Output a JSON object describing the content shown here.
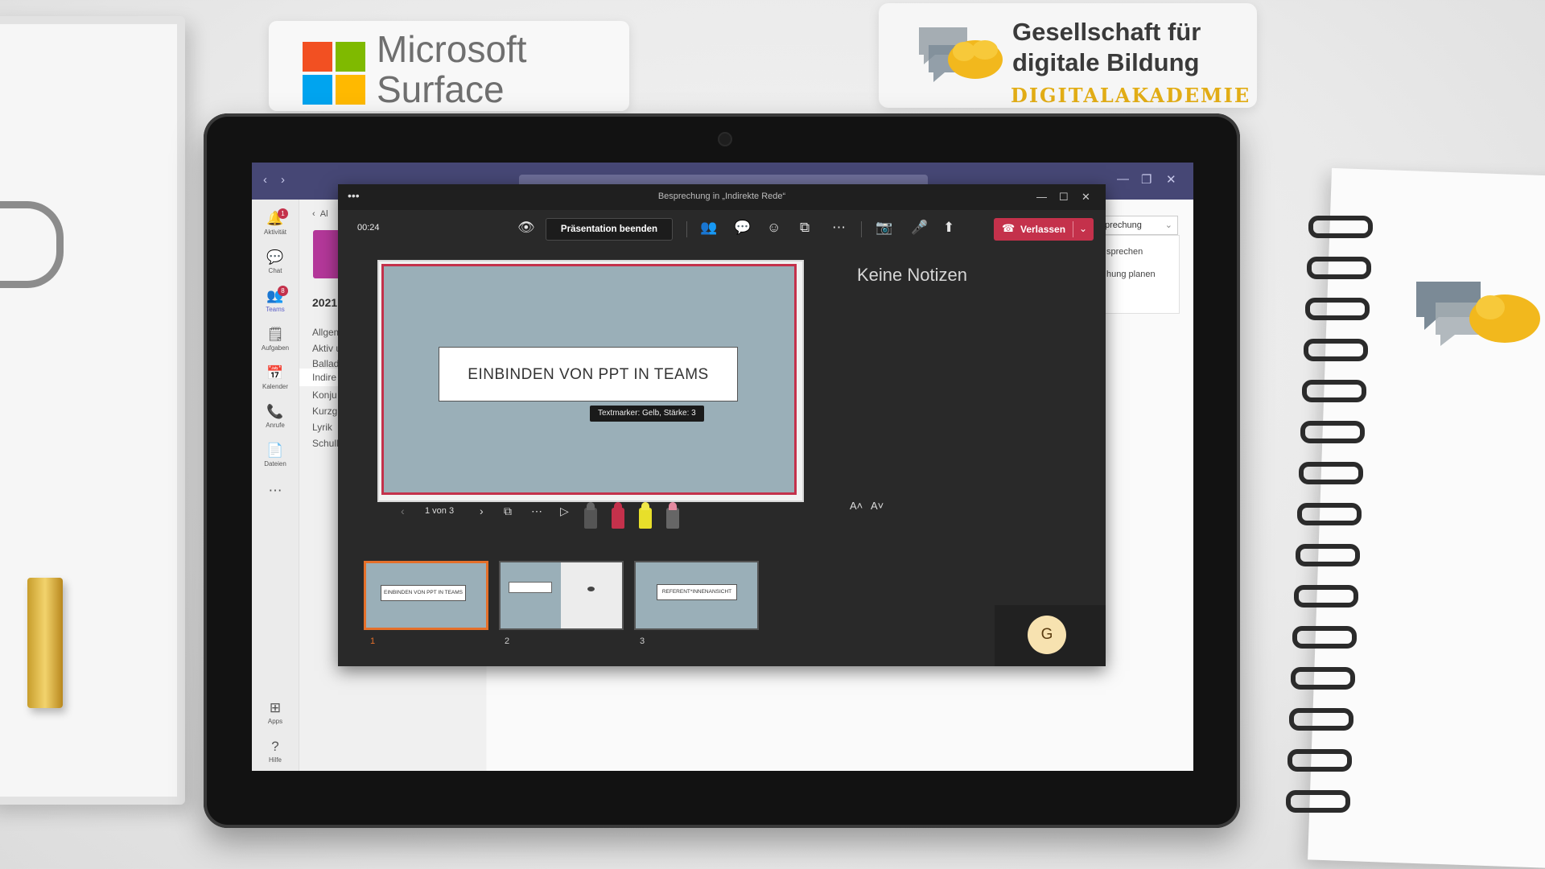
{
  "brand": {
    "microsoft_line1": "Microsoft",
    "microsoft_line2": "Surface",
    "gdb_line1": "Gesellschaft für",
    "gdb_line2": "digitale Bildung",
    "gdb_line3": "DIGITALAKADEMIE"
  },
  "teams": {
    "rail": [
      {
        "label": "Aktivität",
        "icon": "bell-icon",
        "glyph": "🔔",
        "badge": "1"
      },
      {
        "label": "Chat",
        "icon": "chat-icon",
        "glyph": "💬"
      },
      {
        "label": "Teams",
        "icon": "teams-icon",
        "glyph": "👥",
        "badge": "8"
      },
      {
        "label": "Aufgaben",
        "icon": "tasks-icon",
        "glyph": "🗒"
      },
      {
        "label": "Kalender",
        "icon": "calendar-icon",
        "glyph": "📅"
      },
      {
        "label": "Anrufe",
        "icon": "phone-icon",
        "glyph": "📞"
      },
      {
        "label": "Dateien",
        "icon": "files-icon",
        "glyph": "📄"
      },
      {
        "label": "",
        "icon": "more-icon",
        "glyph": "⋯"
      },
      {
        "label": "Apps",
        "icon": "apps-icon",
        "glyph": "⊞"
      },
      {
        "label": "Hilfe",
        "icon": "help-icon",
        "glyph": "?"
      }
    ],
    "back_label": "Al",
    "team_name": "2021",
    "channels": [
      "Allgem",
      "Aktiv u",
      "Ballad",
      "Indire",
      "Konju",
      "Kurzg",
      "Lyrik",
      "Schull"
    ],
    "join_button": "prechung",
    "dropdown_items": [
      "sprechen",
      "hung planen"
    ]
  },
  "meeting": {
    "window_title": "Besprechung in „Indirekte Rede“",
    "timer": "00:24",
    "end_presentation": "Präsentation beenden",
    "leave": "Verlassen",
    "notes": "Keine Notizen",
    "tooltip": "Textmarker: Gelb, Stärke: 3",
    "slide_counter": "1 von 3",
    "slide_title": "EINBINDEN VON PPT IN TEAMS",
    "avatar_initial": "G",
    "font_increase": "A˄",
    "font_decrease": "A˅",
    "thumbnails": [
      {
        "number": "1",
        "title": "EINBINDEN VON PPT IN TEAMS",
        "selected": true
      },
      {
        "number": "2",
        "title": "",
        "selected": false
      },
      {
        "number": "3",
        "title": "REFERENT*INNENANSICHT",
        "selected": false
      }
    ]
  },
  "colors": {
    "teams_purple": "#464775",
    "leave_red": "#c4314b",
    "slide_bg": "#9aafb8",
    "thumb_selected": "#e5702a"
  }
}
